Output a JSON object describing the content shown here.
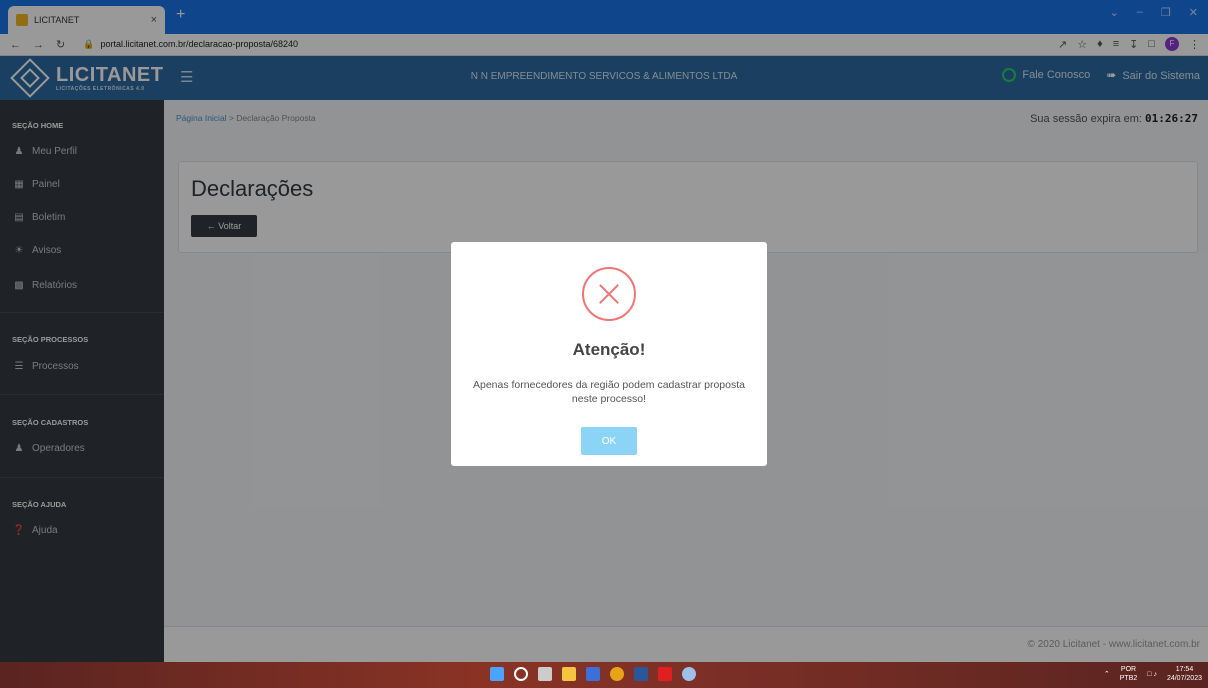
{
  "browser": {
    "tab_title": "LICITANET",
    "tab_close": "×",
    "new_tab": "+",
    "url": "portal.licitanet.com.br/declaracao-proposta/68240",
    "profile_initial": "F"
  },
  "header": {
    "logo_text": "LICITANET",
    "logo_sub": "LICITAÇÕES ELETRÔNICAS 4.0",
    "company": "N N EMPREENDIMENTO SERVICOS & ALIMENTOS LTDA",
    "contact": "Fale Conosco",
    "logout": "Sair do Sistema"
  },
  "sidebar": {
    "sections": [
      {
        "title": "SEÇÃO HOME",
        "items": [
          "Meu Perfil",
          "Painel",
          "Boletim",
          "Avisos",
          "Relatórios"
        ]
      },
      {
        "title": "SEÇÃO PROCESSOS",
        "items": [
          "Processos"
        ]
      },
      {
        "title": "SEÇÃO CADASTROS",
        "items": [
          "Operadores"
        ]
      },
      {
        "title": "SEÇÃO AJUDA",
        "items": [
          "Ajuda"
        ]
      }
    ]
  },
  "main": {
    "breadcrumb_home": "Página Inicial",
    "breadcrumb_sep": ">",
    "breadcrumb_current": "Declaração Proposta",
    "session_label": "Sua sessão expira em:",
    "session_time": "01:26:27",
    "page_title": "Declarações",
    "back_button": "Voltar",
    "footer": "© 2020 Licitanet - www.licitanet.com.br"
  },
  "modal": {
    "title": "Atenção!",
    "message": "Apenas fornecedores da região podem cadastrar proposta neste processo!",
    "ok_label": "OK"
  },
  "taskbar": {
    "lang_top": "POR",
    "lang_bottom": "PTB2",
    "time": "17:54",
    "date": "24/07/2023"
  },
  "colors": {
    "header": "#2c6aa0",
    "sidebar": "#343a40",
    "error": "#f27474",
    "ok_button": "#8cd4f5"
  }
}
